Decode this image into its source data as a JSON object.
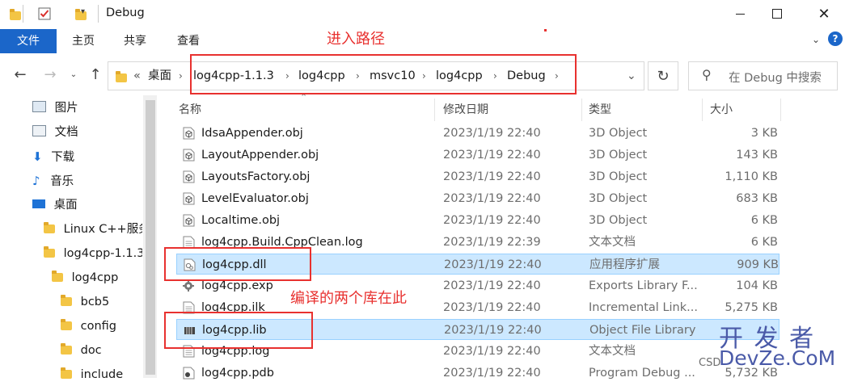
{
  "window": {
    "title": "Debug"
  },
  "ribbon": {
    "tabs": [
      "文件",
      "主页",
      "共享",
      "查看"
    ]
  },
  "address": {
    "overflow": "«",
    "crumbs": [
      "桌面",
      "log4cpp-1.1.3",
      "log4cpp",
      "msvc10",
      "log4cpp",
      "Debug"
    ]
  },
  "search": {
    "placeholder": "在 Debug 中搜索"
  },
  "nav": {
    "items": [
      "图片",
      "文档",
      "下载",
      "音乐",
      "桌面",
      "Linux C++服务",
      "log4cpp-1.1.3",
      "log4cpp",
      "bcb5",
      "config",
      "doc",
      "include"
    ]
  },
  "columns": {
    "name": "名称",
    "date": "修改日期",
    "type": "类型",
    "size": "大小"
  },
  "files": [
    {
      "name": "IdsaAppender.obj",
      "date": "2023/1/19 22:40",
      "type": "3D Object",
      "size": "3 KB",
      "icon": "obj"
    },
    {
      "name": "LayoutAppender.obj",
      "date": "2023/1/19 22:40",
      "type": "3D Object",
      "size": "143 KB",
      "icon": "obj"
    },
    {
      "name": "LayoutsFactory.obj",
      "date": "2023/1/19 22:40",
      "type": "3D Object",
      "size": "1,110 KB",
      "icon": "obj"
    },
    {
      "name": "LevelEvaluator.obj",
      "date": "2023/1/19 22:40",
      "type": "3D Object",
      "size": "683 KB",
      "icon": "obj"
    },
    {
      "name": "Localtime.obj",
      "date": "2023/1/19 22:40",
      "type": "3D Object",
      "size": "6 KB",
      "icon": "obj"
    },
    {
      "name": "log4cpp.Build.CppClean.log",
      "date": "2023/1/19 22:39",
      "type": "文本文档",
      "size": "6 KB",
      "icon": "txt"
    },
    {
      "name": "log4cpp.dll",
      "date": "2023/1/19 22:40",
      "type": "应用程序扩展",
      "size": "909 KB",
      "icon": "dll",
      "selected": true
    },
    {
      "name": "log4cpp.exp",
      "date": "2023/1/19 22:40",
      "type": "Exports Library F...",
      "size": "104 KB",
      "icon": "exp"
    },
    {
      "name": "log4cpp.ilk",
      "date": "2023/1/19 22:40",
      "type": "Incremental Link...",
      "size": "5,275 KB",
      "icon": "txt"
    },
    {
      "name": "log4cpp.lib",
      "date": "2023/1/19 22:40",
      "type": "Object File Library",
      "size": "",
      "icon": "lib",
      "selected": true
    },
    {
      "name": "log4cpp.log",
      "date": "2023/1/19 22:40",
      "type": "文本文档",
      "size": "",
      "icon": "txt"
    },
    {
      "name": "log4cpp.pdb",
      "date": "2023/1/19 22:40",
      "type": "Program Debug ...",
      "size": "5,732 KB",
      "icon": "pdb"
    }
  ],
  "annotations": {
    "path_note": "进入路径",
    "lib_note": "编译的两个库在此"
  },
  "watermark": {
    "cn": "开 发 者",
    "en": "DevZe.CoM",
    "prefix": "CSD"
  },
  "colors": {
    "accent": "#1b66c9",
    "annotation": "#e8312f",
    "selection": "#cce8ff"
  }
}
